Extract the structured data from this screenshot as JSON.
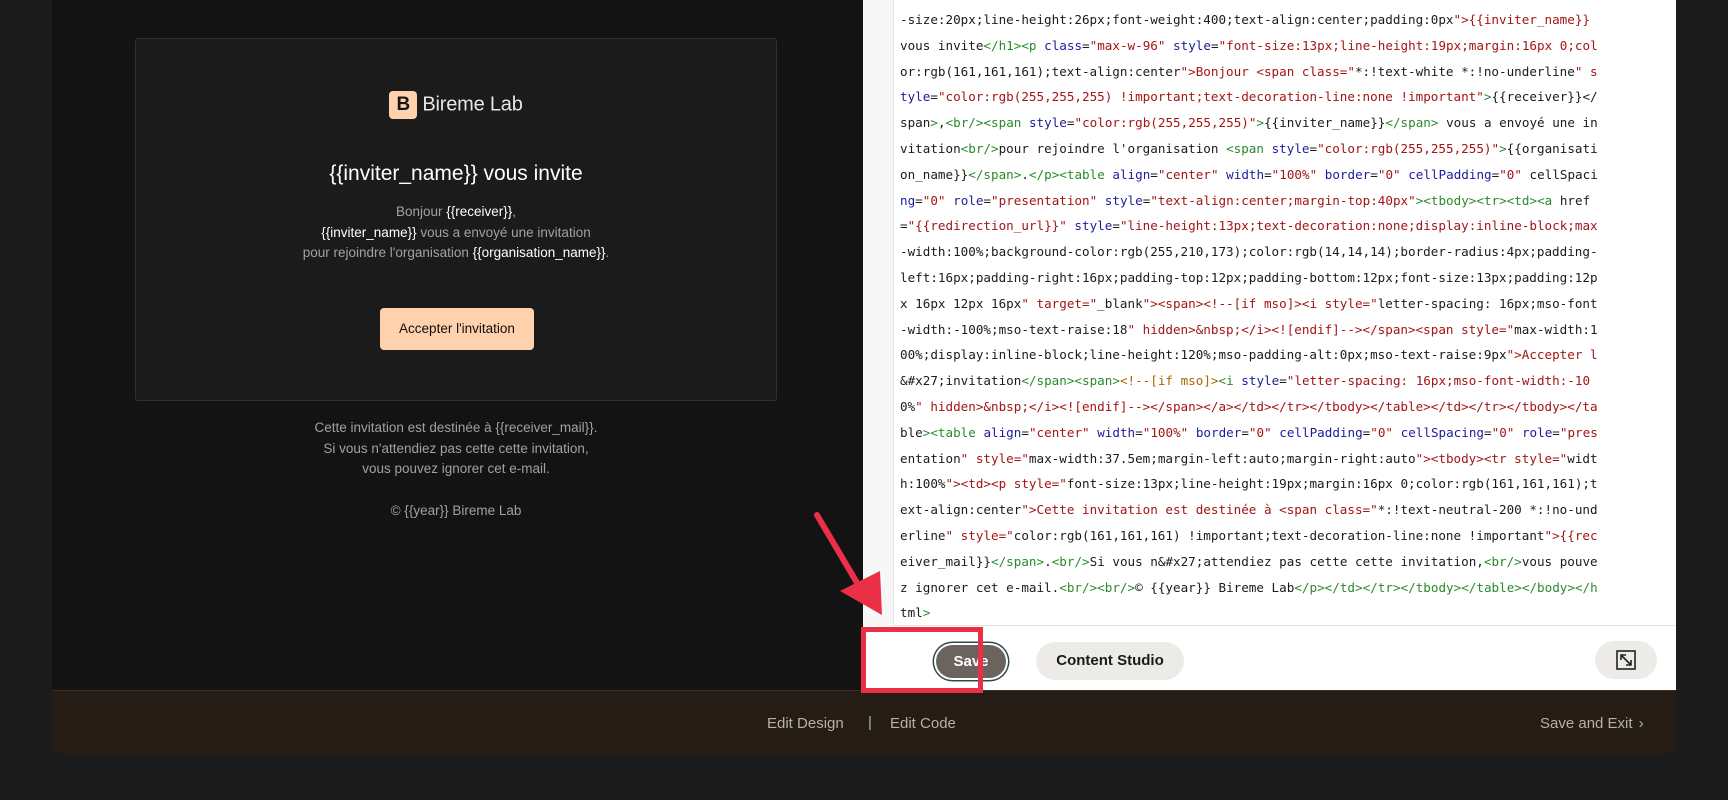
{
  "preview": {
    "brand_mark": "B",
    "brand_name": "Bireme Lab",
    "heading": "{{inviter_name}} vous invite",
    "greeting_prefix": "Bonjour ",
    "receiver": "{{receiver}}",
    "greeting_suffix": ",",
    "inviter_name": "{{inviter_name}}",
    "sent_text": " vous a envoyé une invitation",
    "join_text": "pour rejoindre l'organisation ",
    "organisation_name": "{{organisation_name}}",
    "period": ".",
    "accept_button": "Accepter l'invitation",
    "footer_line1": "Cette invitation est destinée à {{receiver_mail}}.",
    "footer_line2": "Si vous n'attendiez pas cette cette invitation,",
    "footer_line3": "vous pouvez ignorer cet e-mail.",
    "copyright": "© {{year}} Bireme Lab"
  },
  "code": {
    "lines": [
      "-size:20px;line-height:26px;font-weight:400;text-align:center;padding:0px\">{{inviter_name}}",
      "vous invite</h1><p class=\"max-w-96\" style=\"font-size:13px;line-height:19px;margin:16px 0;col",
      "or:rgb(161,161,161);text-align:center\">Bonjour <span class=\"*:!text-white *:!no-underline\" s",
      "tyle=\"color:rgb(255,255,255) !important;text-decoration-line:none !important\">{{receiver}}</",
      "span>,<br/><span style=\"color:rgb(255,255,255)\">{{inviter_name}}</span> vous a envoyé une in",
      "vitation<br/>pour rejoindre l'organisation <span style=\"color:rgb(255,255,255)\">{{organisati",
      "on_name}}</span>.</p><table align=\"center\" width=\"100%\" border=\"0\" cellPadding=\"0\" cellSpaci",
      "ng=\"0\" role=\"presentation\" style=\"text-align:center;margin-top:40px\"><tbody><tr><td><a href",
      "=\"{{redirection_url}}\" style=\"line-height:13px;text-decoration:none;display:inline-block;max",
      "-width:100%;background-color:rgb(255,210,173);color:rgb(14,14,14);border-radius:4px;padding-",
      "left:16px;padding-right:16px;padding-top:12px;padding-bottom:12px;font-size:13px;padding:12p",
      "x 16px 12px 16px\" target=\"_blank\"><span><!--[if mso]><i style=\"letter-spacing: 16px;mso-font",
      "-width:-100%;mso-text-raise:18\" hidden>&nbsp;</i><![endif]--></span><span style=\"max-width:1",
      "00%;display:inline-block;line-height:120%;mso-padding-alt:0px;mso-text-raise:9px\">Accepter l",
      "&#x27;invitation</span><span><!--[if mso]><i style=\"letter-spacing: 16px;mso-font-width:-10",
      "0%\" hidden>&nbsp;</i><![endif]--></span></a></td></tr></tbody></table></td></tr></tbody></ta",
      "ble><table align=\"center\" width=\"100%\" border=\"0\" cellPadding=\"0\" cellSpacing=\"0\" role=\"pres",
      "entation\" style=\"max-width:37.5em;margin-left:auto;margin-right:auto\"><tbody><tr style=\"widt",
      "h:100%\"><td><p style=\"font-size:13px;line-height:19px;margin:16px 0;color:rgb(161,161,161);t",
      "ext-align:center\">Cette invitation est destinée à <span class=\"*:!text-neutral-200 *:!no-und",
      "erline\" style=\"color:rgb(161,161,161) !important;text-decoration-line:none !important\">{{rec",
      "eiver_mail}}</span>.<br/>Si vous n&#x27;attendiez pas cette cette invitation,<br/>vous pouve",
      "z ignorer cet e-mail.<br/><br/>© {{year}} Bireme Lab</p></td></tr></tbody></table></body></h",
      "tml>"
    ]
  },
  "toolbar": {
    "save_label": "Save",
    "content_studio_label": "Content Studio",
    "expand_icon": "expand-icon"
  },
  "bottom_nav": {
    "edit_design": "Edit Design",
    "separator": "|",
    "edit_code": "Edit Code",
    "save_and_exit": "Save and Exit",
    "chevron": "›"
  },
  "colors": {
    "accent_button": "#ffd2ad",
    "save_button": "#6b635e",
    "annotation_red": "#ea2f47"
  }
}
